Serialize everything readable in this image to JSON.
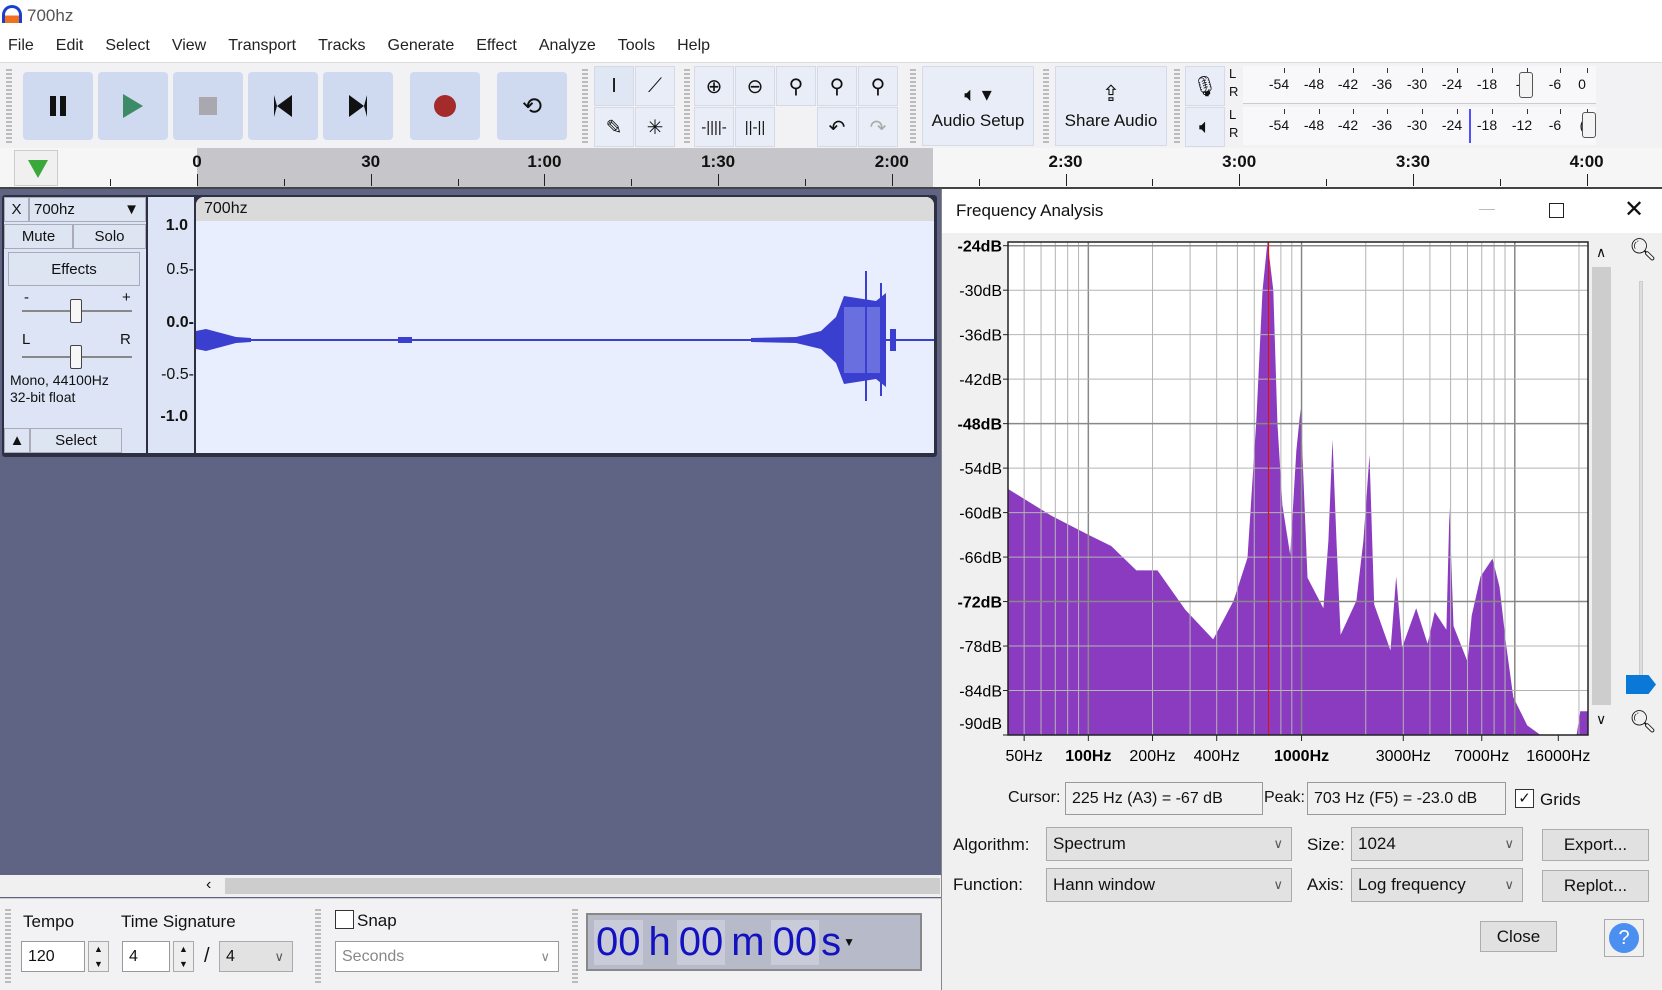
{
  "app": {
    "title": "700hz"
  },
  "menu": [
    "File",
    "Edit",
    "Select",
    "View",
    "Transport",
    "Tracks",
    "Generate",
    "Effect",
    "Analyze",
    "Tools",
    "Help"
  ],
  "toolbar": {
    "audio_setup": "Audio Setup",
    "share_audio": "Share Audio",
    "meter_ticks_record": [
      "-54",
      "-48",
      "-42",
      "-36",
      "-30",
      "-24",
      "-18",
      "-1",
      "-6",
      "0"
    ],
    "meter_ticks_play": [
      "-54",
      "-48",
      "-42",
      "-36",
      "-30",
      "-24",
      "-18",
      "-12",
      "-6",
      "("
    ],
    "meter_channels": [
      "L",
      "R"
    ]
  },
  "timeline": {
    "labels": [
      "0",
      "30",
      "1:00",
      "1:30",
      "2:00",
      "2:30",
      "3:00",
      "3:30",
      "4:00"
    ]
  },
  "track": {
    "name": "700hz",
    "clip_name": "700hz",
    "mute": "Mute",
    "solo": "Solo",
    "effects": "Effects",
    "gain_minus": "-",
    "gain_plus": "+",
    "pan_left": "L",
    "pan_right": "R",
    "info_line1": "Mono, 44100Hz",
    "info_line2": "32-bit float",
    "select": "Select",
    "close": "X",
    "ruler": [
      "1.0",
      "0.5-",
      "0.0-",
      "-0.5-",
      "-1.0"
    ]
  },
  "bottom": {
    "tempo_label": "Tempo",
    "tempo_value": "120",
    "timesig_label": "Time Signature",
    "timesig_num": "4",
    "timesig_sep": "/",
    "timesig_den": "4",
    "snap_label": "Snap",
    "snap_checked": false,
    "snap_unit": "Seconds",
    "time_display": [
      "00",
      "h",
      "00",
      "m",
      "00",
      "s"
    ]
  },
  "frequency_analysis": {
    "title": "Frequency Analysis",
    "cursor_label": "Cursor:",
    "cursor_value": "225 Hz (A3) = -67 dB",
    "peak_label": "Peak:",
    "peak_value": "703 Hz (F5) = -23.0 dB",
    "grids_label": "Grids",
    "grids_checked": true,
    "algorithm_label": "Algorithm:",
    "algorithm_value": "Spectrum",
    "function_label": "Function:",
    "function_value": "Hann window",
    "size_label": "Size:",
    "size_value": "1024",
    "axis_label": "Axis:",
    "axis_value": "Log frequency",
    "export": "Export...",
    "replot": "Replot...",
    "close": "Close",
    "help": "?"
  },
  "chart_data": {
    "type": "area",
    "x_scale": "log",
    "xlim": [
      42,
      22050
    ],
    "ylim": [
      -90,
      -23.5
    ],
    "grid": true,
    "color": "#8b3bbf",
    "cursor_line_hz": 700,
    "cursor_color": "#e01010",
    "y_ticks": [
      -24,
      -30,
      -36,
      -42,
      -48,
      -54,
      -60,
      -66,
      -72,
      -78,
      -84,
      -90
    ],
    "y_tick_labels": [
      "-24dB",
      "-30dB",
      "-36dB",
      "-42dB",
      "-48dB",
      "-54dB",
      "-60dB",
      "-66dB",
      "-72dB",
      "-78dB",
      "-84dB",
      "-90dB"
    ],
    "x_ticks": [
      50,
      100,
      200,
      400,
      1000,
      3000,
      7000,
      16000
    ],
    "x_tick_labels": [
      "50Hz",
      "100Hz",
      "200Hz",
      "400Hz",
      "1000Hz",
      "3000Hz",
      "7000Hz",
      "16000Hz"
    ],
    "points": [
      [
        42,
        -56.8
      ],
      [
        67,
        -60.4
      ],
      [
        100,
        -63
      ],
      [
        128,
        -64.5
      ],
      [
        168,
        -67.8
      ],
      [
        211,
        -67.8
      ],
      [
        285,
        -73.1
      ],
      [
        385,
        -77.1
      ],
      [
        480,
        -71.9
      ],
      [
        558,
        -66.1
      ],
      [
        614,
        -47.4
      ],
      [
        656,
        -30.1
      ],
      [
        692,
        -23.4
      ],
      [
        737,
        -30
      ],
      [
        770,
        -47.9
      ],
      [
        813,
        -59
      ],
      [
        885,
        -65.7
      ],
      [
        945,
        -51.7
      ],
      [
        990,
        -46
      ],
      [
        1066,
        -68.8
      ],
      [
        1266,
        -72.9
      ],
      [
        1336,
        -63.8
      ],
      [
        1397,
        -50.1
      ],
      [
        1460,
        -64.2
      ],
      [
        1525,
        -76.5
      ],
      [
        1808,
        -71.9
      ],
      [
        1951,
        -63.8
      ],
      [
        2083,
        -52.2
      ],
      [
        2192,
        -72.4
      ],
      [
        2613,
        -78.6
      ],
      [
        2780,
        -68.6
      ],
      [
        2963,
        -78.2
      ],
      [
        3450,
        -72.9
      ],
      [
        3900,
        -77.7
      ],
      [
        4210,
        -73.4
      ],
      [
        4780,
        -75.8
      ],
      [
        4940,
        -59.4
      ],
      [
        5160,
        -75.3
      ],
      [
        6000,
        -80.1
      ],
      [
        6280,
        -73.9
      ],
      [
        6910,
        -68.6
      ],
      [
        7860,
        -66.2
      ],
      [
        8480,
        -70
      ],
      [
        9140,
        -78.2
      ],
      [
        9840,
        -84.9
      ],
      [
        11440,
        -88.7
      ],
      [
        13200,
        -90.5
      ],
      [
        19500,
        -90.5
      ],
      [
        20300,
        -86.8
      ],
      [
        22050,
        -86.8
      ]
    ]
  },
  "colors": {
    "accent": "#3a3fd0",
    "spectrum": "#8b3bbf",
    "record": "#a52a2a",
    "play": "#3d8a66"
  }
}
